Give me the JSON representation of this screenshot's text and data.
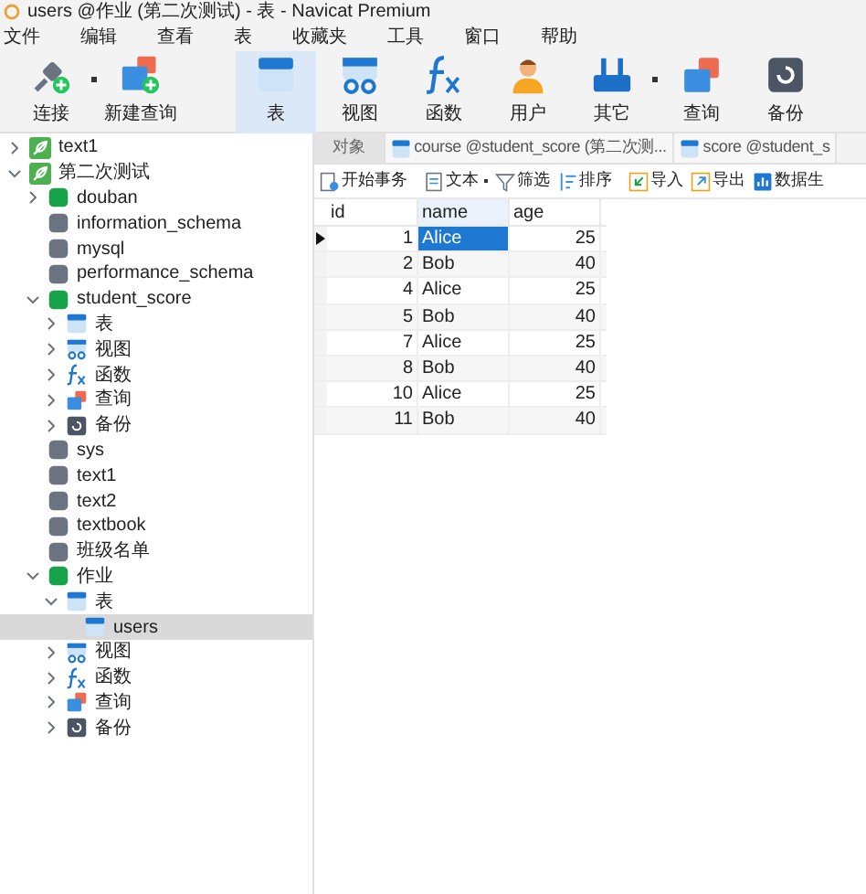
{
  "window": {
    "title": "users @作业 (第二次测试) - 表 - Navicat Premium"
  },
  "menu": [
    "文件",
    "编辑",
    "查看",
    "表",
    "收藏夹",
    "工具",
    "窗口",
    "帮助"
  ],
  "toolbar": [
    {
      "label": "连接",
      "kind": "connect",
      "dropdown": true,
      "selected": false
    },
    {
      "label": "新建查询",
      "kind": "new-query",
      "dropdown": false,
      "selected": false
    },
    {
      "label": "表",
      "kind": "table",
      "dropdown": false,
      "selected": true
    },
    {
      "label": "视图",
      "kind": "view",
      "dropdown": false,
      "selected": false
    },
    {
      "label": "函数",
      "kind": "function",
      "dropdown": false,
      "selected": false
    },
    {
      "label": "用户",
      "kind": "user",
      "dropdown": false,
      "selected": false
    },
    {
      "label": "其它",
      "kind": "other",
      "dropdown": true,
      "selected": false
    },
    {
      "label": "查询",
      "kind": "query",
      "dropdown": false,
      "selected": false
    },
    {
      "label": "备份",
      "kind": "backup",
      "dropdown": false,
      "selected": false
    }
  ],
  "sidebar": {
    "items": [
      {
        "label": "text1",
        "kind": "connection",
        "expanded": false,
        "selected": false
      },
      {
        "label": "第二次测试",
        "kind": "connection",
        "expanded": true,
        "selected": false,
        "children": [
          {
            "label": "douban",
            "kind": "db-open",
            "expanded": false,
            "selected": false
          },
          {
            "label": "information_schema",
            "kind": "db",
            "selected": false
          },
          {
            "label": "mysql",
            "kind": "db",
            "selected": false
          },
          {
            "label": "performance_schema",
            "kind": "db",
            "selected": false
          },
          {
            "label": "student_score",
            "kind": "db-open",
            "expanded": true,
            "selected": false,
            "children": [
              {
                "label": "表",
                "kind": "table",
                "expanded": false,
                "selected": false
              },
              {
                "label": "视图",
                "kind": "view",
                "expanded": false,
                "selected": false
              },
              {
                "label": "函数",
                "kind": "function",
                "expanded": false,
                "selected": false
              },
              {
                "label": "查询",
                "kind": "query",
                "expanded": false,
                "selected": false
              },
              {
                "label": "备份",
                "kind": "backup",
                "expanded": false,
                "selected": false
              }
            ]
          },
          {
            "label": "sys",
            "kind": "db",
            "selected": false
          },
          {
            "label": "text1",
            "kind": "db",
            "selected": false
          },
          {
            "label": "text2",
            "kind": "db",
            "selected": false
          },
          {
            "label": "textbook",
            "kind": "db",
            "selected": false
          },
          {
            "label": "班级名单",
            "kind": "db",
            "selected": false
          },
          {
            "label": "作业",
            "kind": "db-open",
            "expanded": true,
            "selected": false,
            "children": [
              {
                "label": "表",
                "kind": "table",
                "expanded": true,
                "selected": false,
                "children": [
                  {
                    "label": "users",
                    "kind": "table",
                    "selected": true
                  }
                ]
              },
              {
                "label": "视图",
                "kind": "view",
                "expanded": false,
                "selected": false
              },
              {
                "label": "函数",
                "kind": "function",
                "expanded": false,
                "selected": false
              },
              {
                "label": "查询",
                "kind": "query",
                "expanded": false,
                "selected": false
              },
              {
                "label": "备份",
                "kind": "backup",
                "expanded": false,
                "selected": false
              }
            ]
          }
        ]
      }
    ]
  },
  "tabs": [
    {
      "label": "对象",
      "kind": "objects",
      "selected": true
    },
    {
      "label": "course @student_score (第二次测...",
      "kind": "table",
      "selected": false
    },
    {
      "label": "score @student_s",
      "kind": "table",
      "selected": false
    }
  ],
  "grid_toolbar": [
    {
      "label": "开始事务",
      "kind": "transaction",
      "dropdown": false
    },
    {
      "label": "文本",
      "kind": "text",
      "dropdown": true
    },
    {
      "label": "筛选",
      "kind": "filter",
      "dropdown": false
    },
    {
      "label": "排序",
      "kind": "sort",
      "dropdown": false
    },
    {
      "label": "导入",
      "kind": "import",
      "dropdown": false
    },
    {
      "label": "导出",
      "kind": "export",
      "dropdown": false
    },
    {
      "label": "数据生",
      "kind": "generate",
      "dropdown": false
    }
  ],
  "table": {
    "columns": [
      "id",
      "name",
      "age"
    ],
    "rows": [
      {
        "cells": [
          "1",
          "Alice",
          "25"
        ],
        "selected": true
      },
      {
        "cells": [
          "2",
          "Bob",
          "40"
        ],
        "selected": false
      },
      {
        "cells": [
          "4",
          "Alice",
          "25"
        ],
        "selected": false
      },
      {
        "cells": [
          "5",
          "Bob",
          "40"
        ],
        "selected": false
      },
      {
        "cells": [
          "7",
          "Alice",
          "25"
        ],
        "selected": false
      },
      {
        "cells": [
          "8",
          "Bob",
          "40"
        ],
        "selected": false
      },
      {
        "cells": [
          "10",
          "Alice",
          "25"
        ],
        "selected": false
      },
      {
        "cells": [
          "11",
          "Bob",
          "40"
        ],
        "selected": false
      }
    ]
  }
}
